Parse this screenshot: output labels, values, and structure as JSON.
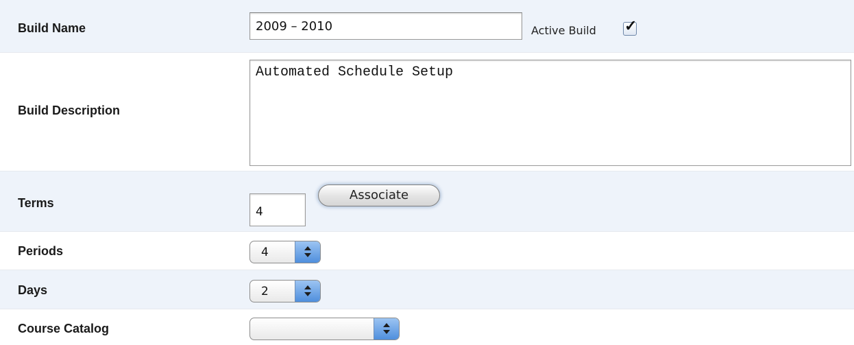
{
  "form": {
    "build_name": {
      "label": "Build Name",
      "value": "2009 – 2010"
    },
    "active_build": {
      "label": "Active Build",
      "checked": true
    },
    "build_description": {
      "label": "Build Description",
      "value": "Automated Schedule Setup"
    },
    "terms": {
      "label": "Terms",
      "value": "4",
      "associate_label": "Associate"
    },
    "periods": {
      "label": "Periods",
      "selected": "4"
    },
    "days": {
      "label": "Days",
      "selected": "2"
    },
    "course_catalog": {
      "label": "Course Catalog",
      "selected": ""
    }
  },
  "colors": {
    "row_alt": "#eef3fa",
    "select_arrow": "#4f8fdd"
  },
  "icons": {
    "checkbox_mark": "check-icon",
    "select_arrows": "updown-arrows-icon"
  }
}
